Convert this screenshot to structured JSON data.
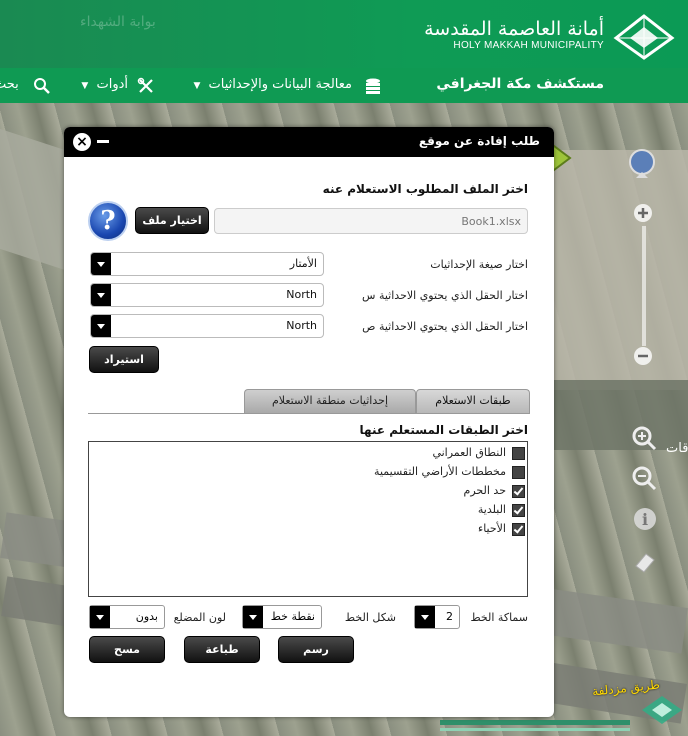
{
  "header": {
    "brand_ar": "أمانة العاصمة المقدسة",
    "brand_en": "HOLY MAKKAH MUNICIPALITY",
    "logo_icon": "makkah-municipality-logo-icon",
    "ghost_text": "بوابة الشهداء"
  },
  "navbar": {
    "title": "مستكشف مكة الجغرافي",
    "data_menu": "معالجة البيانات والإحداثيات",
    "tools_menu": "أدوات",
    "search": "بحث"
  },
  "dialog": {
    "title": "طلب إفادة عن موقع",
    "section_file": "اختر الملف المطلوب الاستعلام عنه",
    "file_value": "Book1.xlsx",
    "choose_file_button": "اختيار ملف",
    "coord_format_label": "اختار صيغة الإحداثيات",
    "coord_format_value": "الأمتار",
    "x_field_label": "اختار الحقل الذي يحتوي الاحداثية س",
    "x_field_value": "North",
    "y_field_label": "اختار الحقل الذي يحتوي الاحداثية ص",
    "y_field_value": "North",
    "import_button": "استيراد",
    "tabs": {
      "layers": "طبقات الاستعلام",
      "coords": "إحداثيات منطقة الاستعلام"
    },
    "layers_title": "اختر الطبقات المستعلم عنها",
    "layers": [
      {
        "label": "النطاق العمراني",
        "checked": false
      },
      {
        "label": "مخططات الأراضي التقسيمية",
        "checked": false
      },
      {
        "label": "حد الحرم",
        "checked": true
      },
      {
        "label": "البلدية",
        "checked": true
      },
      {
        "label": "الأحياء",
        "checked": true
      }
    ],
    "line_width_label": "سماكة الخط",
    "line_width_value": "2",
    "line_style_label": "شكل الخط",
    "line_style_value": "نقطة خط",
    "fill_color_label": "لون المضلع",
    "fill_color_value": "بدون",
    "draw_button": "رسم",
    "print_button": "طباعة",
    "clear_button": "مسح"
  },
  "map": {
    "road_label": "طريق مزدلفة",
    "edge_label": "قات"
  },
  "colors": {
    "header_green": "#10924f",
    "dialog_bar": "#000000",
    "road_label": "#ffd800"
  }
}
